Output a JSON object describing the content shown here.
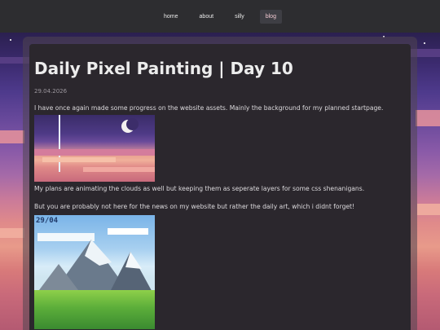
{
  "nav": {
    "items": [
      {
        "label": "home"
      },
      {
        "label": "about"
      },
      {
        "label": "silly"
      },
      {
        "label": "blog",
        "active": true
      }
    ]
  },
  "post": {
    "title": "Daily Pixel Painting | Day 10",
    "date": "29.04.2026",
    "paragraph1": "I have once again made some progress on the website assets. Mainly the background for my planned startpage.",
    "paragraph2": "My plans are animating the clouds as well but keeping them as seperate layers for some css shenanigans.",
    "paragraph3": "But you are probably not here for the news on my website but rather the daily art, which i didnt forget!",
    "image2_tag": "29/04"
  },
  "colors": {
    "nav_bg": "#2d2d30",
    "panel_bg": "#2b272d",
    "active_tab_bg": "#3e3e44",
    "text": "#dcdadd"
  }
}
